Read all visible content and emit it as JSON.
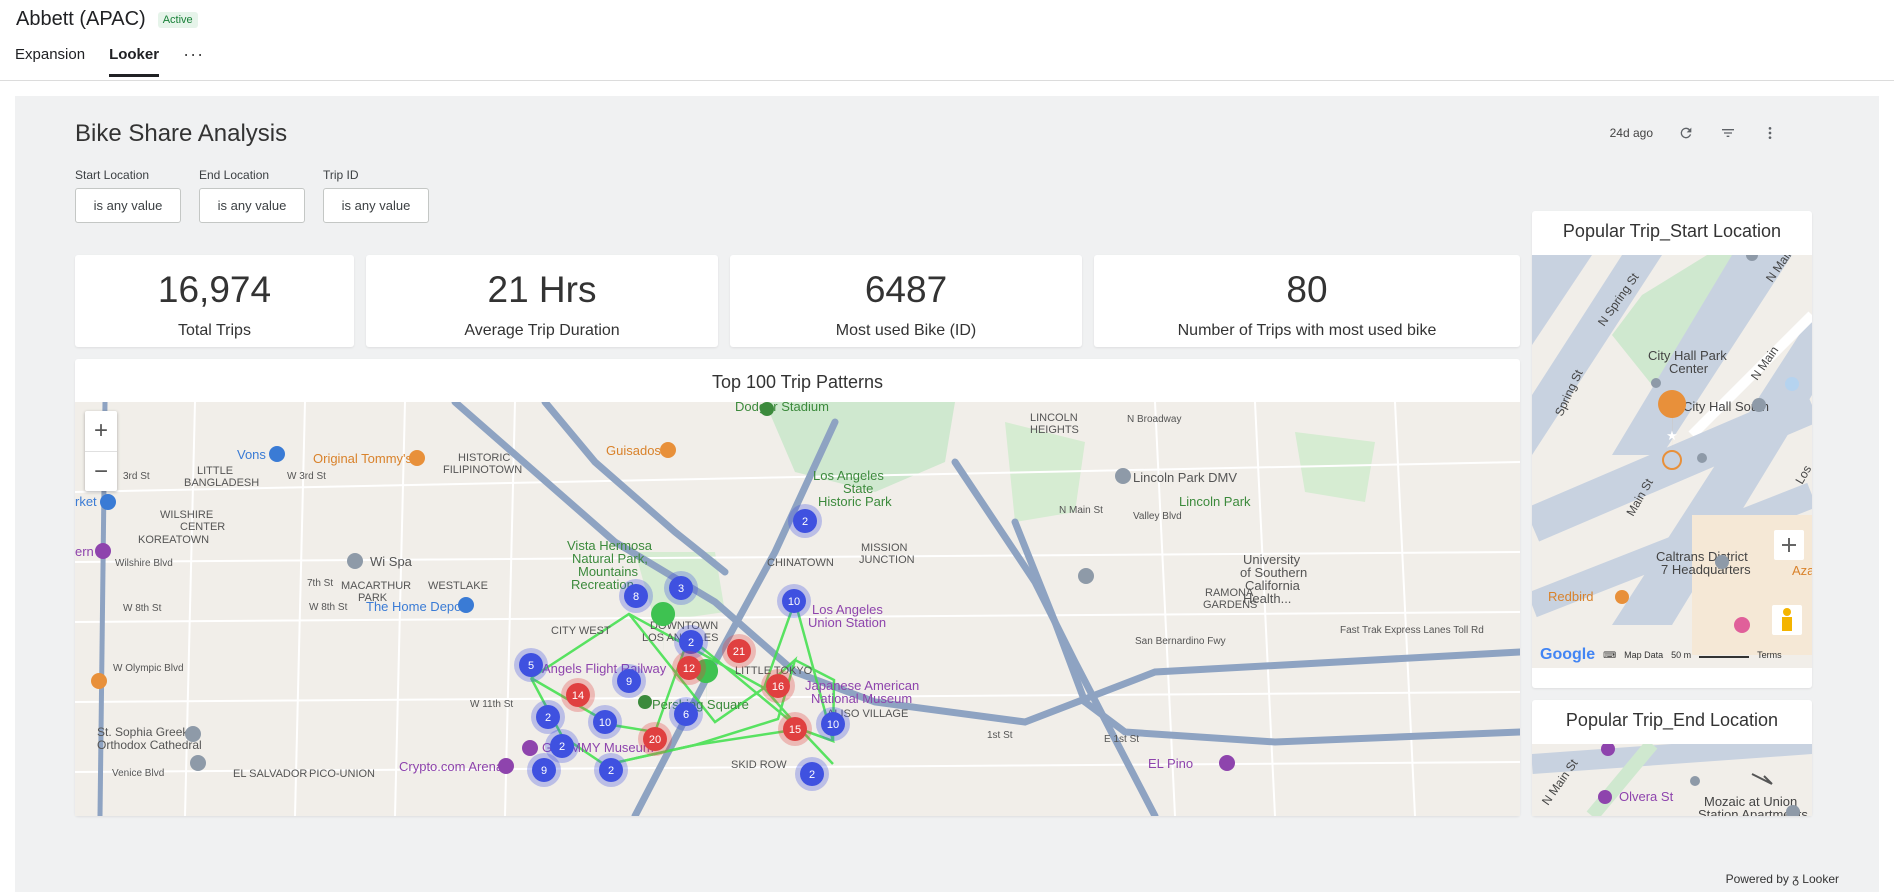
{
  "app": {
    "title": "Abbett (APAC)",
    "status": "Active"
  },
  "tabs": [
    {
      "label": "Expansion"
    },
    {
      "label": "Looker"
    }
  ],
  "dashboard": {
    "title": "Bike Share Analysis",
    "updated": "24d ago",
    "filters": [
      {
        "label": "Start Location",
        "value": "is any value"
      },
      {
        "label": "End Location",
        "value": "is any value"
      },
      {
        "label": "Trip ID",
        "value": "is any value"
      }
    ],
    "kpis": [
      {
        "value": "16,974",
        "label": "Total Trips"
      },
      {
        "value": "21 Hrs",
        "label": "Average Trip Duration"
      },
      {
        "value": "6487",
        "label": "Most used Bike (ID)"
      },
      {
        "value": "80",
        "label": "Number of Trips with most used bike"
      }
    ],
    "trip_map": {
      "title": "Top 100 Trip Patterns",
      "zoom_in": "+",
      "zoom_out": "−",
      "labels": {
        "dodger": "Dodger Stadium",
        "lincoln_heights": "LINCOLN",
        "lincoln_heights2": "HEIGHTS",
        "n_broadway": "N Broadway",
        "historic": "HISTORIC",
        "filipinotown": "FILIPINOTOWN",
        "little": "LITTLE",
        "bangladesh": "BANGLADESH",
        "vons": "Vons",
        "tommys": "Original Tommy's",
        "guisados": "Guisados",
        "la_state": "Los Angeles",
        "la_state2": "State",
        "la_state3": "Historic Park",
        "lincoln_dmv": "Lincoln Park DMV",
        "lincoln_park": "Lincoln Park",
        "wilshire": "WILSHIRE",
        "center": "CENTER",
        "koreatown": "KOREATOWN",
        "vista": "Vista Hermosa",
        "natural": "Natural Park,",
        "mountains": "Mountains",
        "recreation": "Recreation...",
        "mission": "MISSION",
        "junction": "JUNCTION",
        "chinatown": "CHINATOWN",
        "usc": "University",
        "usc2": "of Southern",
        "usc3": "California",
        "usc4": "Health...",
        "wilshire_blvd": "Wilshire Blvd",
        "wi_spa": "Wi Spa",
        "macarthur": "MACARTHUR",
        "park": "PARK",
        "westlake": "WESTLAKE",
        "home_depot": "The Home Depot",
        "city_west": "CITY WEST",
        "downtown": "DOWNTOWN",
        "los_angeles": "LOS ANGELES",
        "union_station": "Los Angeles",
        "union_station2": "Union Station",
        "ramona": "RAMONA",
        "gardens": "GARDENS",
        "angels_flight": "Angels Flight Railway",
        "little_tokyo": "LITTLE TOKYO",
        "japanese": "Japanese American",
        "japanese2": "National Museum",
        "pershing": "Pershing Square",
        "aliso": "ALISO VILLAGE",
        "st_sophia": "St. Sophia Greek",
        "orthodox": "Orthodox Cathedral",
        "grammy": "GRAMMY Museum",
        "crypto": "Crypto.com Arena",
        "skid_row": "SKID ROW",
        "el_salvador": "EL SALVADOR",
        "pico_union": "PICO-UNION",
        "el_pino": "EL Pino",
        "w_olympic": "W Olympic Blvd",
        "venice": "Venice Blvd",
        "market": "rket",
        "ern": "ern",
        "w_3rd": "W 3rd St",
        "third": "3rd St",
        "w_8th": "W 8th St",
        "seventh": "7th St",
        "w_8th_b": "W 8th St",
        "n_main": "N Main St",
        "valley": "Valley Blvd",
        "fast_trak": "Fast Trak Express Lanes Toll Rd",
        "san_bern": "San Bernardino Fwy",
        "first": "1st St",
        "e_first": "E 1st St",
        "w_11th": "W 11th St"
      },
      "clusters": [
        {
          "count": "2",
          "color": "#3f51e0"
        },
        {
          "count": "8",
          "color": "#3f51e0"
        },
        {
          "count": "3",
          "color": "#3f51e0"
        },
        {
          "count": "10",
          "color": "#3f51e0"
        },
        {
          "count": "2",
          "color": "#3f51e0"
        },
        {
          "count": "21",
          "color": "#e04040"
        },
        {
          "count": "5",
          "color": "#3f51e0"
        },
        {
          "count": "9",
          "color": "#3f51e0"
        },
        {
          "count": "12",
          "color": "#e04040"
        },
        {
          "count": "14",
          "color": "#e04040"
        },
        {
          "count": "16",
          "color": "#e04040"
        },
        {
          "count": "2",
          "color": "#3f51e0"
        },
        {
          "count": "10",
          "color": "#3f51e0"
        },
        {
          "count": "6",
          "color": "#3f51e0"
        },
        {
          "count": "15",
          "color": "#e04040"
        },
        {
          "count": "10",
          "color": "#3f51e0"
        },
        {
          "count": "2",
          "color": "#3f51e0"
        },
        {
          "count": "20",
          "color": "#e04040"
        },
        {
          "count": "2",
          "color": "#3f51e0"
        },
        {
          "count": "9",
          "color": "#3f51e0"
        },
        {
          "count": "2",
          "color": "#3f51e0"
        }
      ]
    },
    "start_map": {
      "title": "Popular Trip_Start Location",
      "labels": {
        "n_spring": "N Spring St",
        "n_main": "N Main",
        "city_hall_park": "City Hall Park",
        "center": "Center",
        "city_hall_south": "City Hall South",
        "spring": "Spring St",
        "main": "Main St",
        "caltrans": "Caltrans District",
        "hq": "7 Headquarters",
        "redbird": "Redbird",
        "aza": "Aza",
        "los": "Los"
      },
      "attribution": {
        "google": "Google",
        "map_data": "Map Data",
        "scale": "50 m",
        "terms": "Terms"
      }
    },
    "end_map": {
      "title": "Popular Trip_End Location",
      "labels": {
        "n_main": "N Main St",
        "olvera": "Olvera St",
        "mozaic": "Mozaic at Union",
        "station": "Station Apartments"
      }
    },
    "powered_by": "Powered by ",
    "looker": "Looker"
  }
}
